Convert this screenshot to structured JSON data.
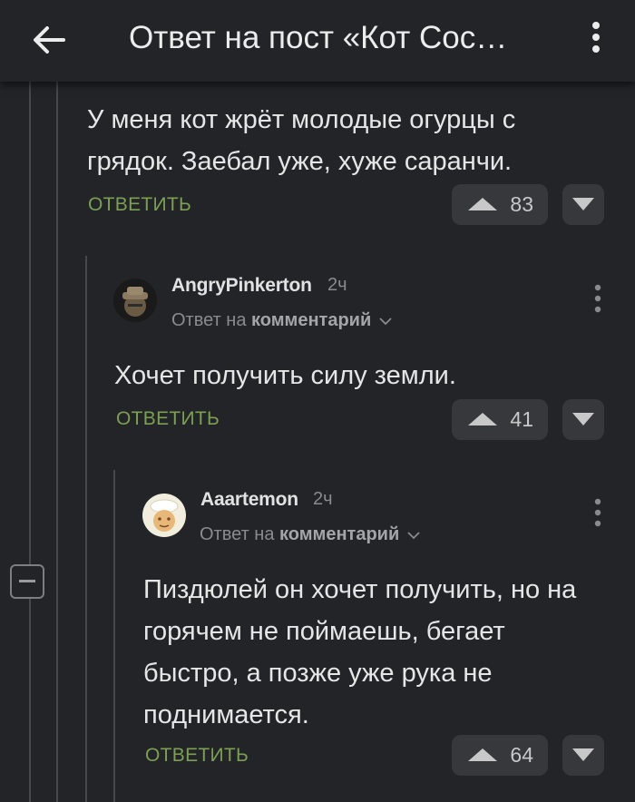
{
  "header": {
    "title": "Ответ на пост «Кот Сос…"
  },
  "comments": [
    {
      "text": "У меня кот жрёт молодые огурцы с грядок. Заебал уже, хуже саранчи.",
      "reply_label": "ОТВЕТИТЬ",
      "votes": "83"
    },
    {
      "username": "AngryPinkerton",
      "time": "2ч",
      "reply_prefix": "Ответ на",
      "reply_target": "комментарий",
      "text": "Хочет получить силу земли.",
      "reply_label": "ОТВЕТИТЬ",
      "votes": "41"
    },
    {
      "username": "Aaartemon",
      "time": "2ч",
      "reply_prefix": "Ответ на",
      "reply_target": "комментарий",
      "text": "Пиздюлей он хочет получить, но на горячем не поймаешь, бегает быстро, а позже уже рука не поднимается.",
      "reply_label": "ОТВЕТИТЬ",
      "votes": "64"
    }
  ],
  "colors": {
    "background": "#232427",
    "accent_green": "#7ba052",
    "vote_button": "#37383c"
  },
  "icons": [
    "back-arrow-icon",
    "more-vertical-icon",
    "vote-up-icon",
    "vote-down-icon",
    "collapse-thread-icon",
    "chevron-down-icon"
  ]
}
